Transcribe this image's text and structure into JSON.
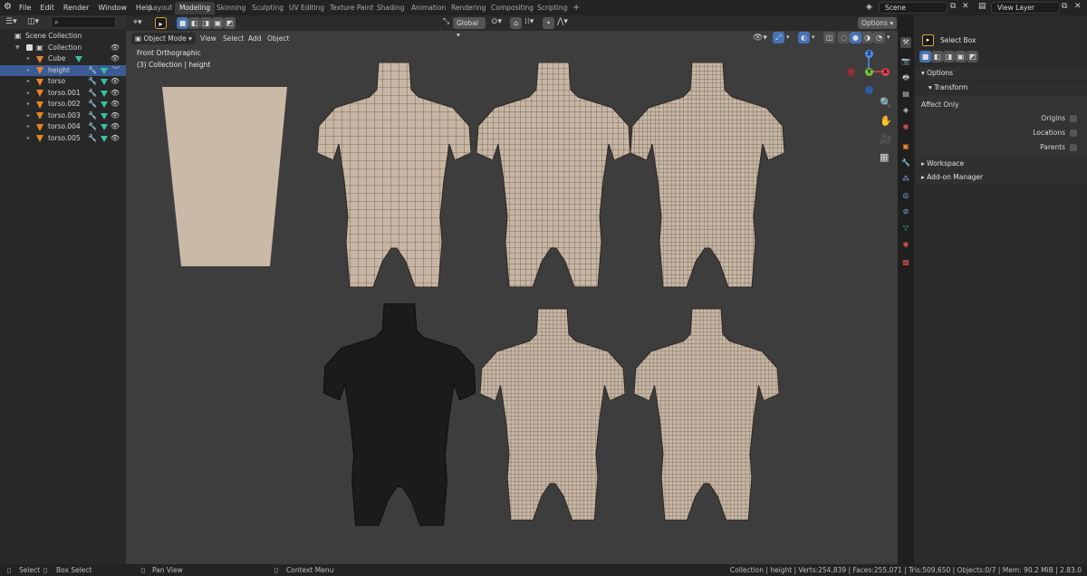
{
  "topbar": {
    "menus": [
      "File",
      "Edit",
      "Render",
      "Window",
      "Help"
    ],
    "workspaces": [
      "Layout",
      "Modeling",
      "Skinning",
      "Sculpting",
      "UV Editing",
      "Texture Paint",
      "Shading",
      "Animation",
      "Rendering",
      "Compositing",
      "Scripting"
    ],
    "active_workspace": "Modeling",
    "add_tab": "+",
    "scene": "Scene",
    "view_layer": "View Layer"
  },
  "outliner": {
    "root": "Scene Collection",
    "collection": "Collection",
    "items": [
      {
        "name": "Cube",
        "selected": false,
        "modifier": false
      },
      {
        "name": "height",
        "selected": true,
        "modifier": true
      },
      {
        "name": "torso",
        "selected": false,
        "modifier": true
      },
      {
        "name": "torso.001",
        "selected": false,
        "modifier": true
      },
      {
        "name": "torso.002",
        "selected": false,
        "modifier": true
      },
      {
        "name": "torso.003",
        "selected": false,
        "modifier": true
      },
      {
        "name": "torso.004",
        "selected": false,
        "modifier": true
      },
      {
        "name": "torso.005",
        "selected": false,
        "modifier": true
      }
    ]
  },
  "viewport": {
    "transform_orientation": "Global",
    "options_label": "Options",
    "mode": "Object Mode",
    "menus": [
      "View",
      "Select",
      "Add",
      "Object"
    ],
    "view_name": "Front Orthographic",
    "collection_info": "(3) Collection | height",
    "gizmo": {
      "z": "Z",
      "y": "Y",
      "x": "X"
    },
    "colors": {
      "mesh": "#cbb9a8",
      "wire": "#3a332c",
      "dark_mesh": "#1a1a1a",
      "background": "#3d3d3d"
    }
  },
  "properties": {
    "tool_name": "Select Box",
    "options_label": "Options",
    "transform_label": "Transform",
    "affect_only_label": "Affect Only",
    "checkboxes": [
      "Origins",
      "Locations",
      "Parents"
    ],
    "workspace_label": "Workspace",
    "addon_label": "Add-on Manager"
  },
  "statusbar": {
    "select": "Select",
    "box_select": "Box Select",
    "pan_view": "Pan View",
    "context_menu": "Context Menu",
    "stats": "Collection | height | Verts:254,839 | Faces:255,071 | Tris:509,650 | Objects:0/7 | Mem: 90.2 MiB | 2.83.0"
  }
}
